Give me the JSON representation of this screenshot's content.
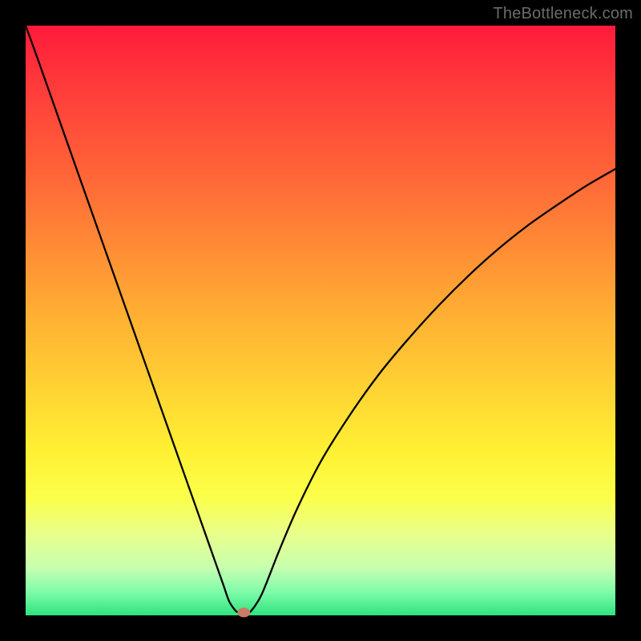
{
  "watermark": "TheBottleneck.com",
  "marker": {
    "color": "#cb7a66",
    "rx": 8,
    "ry": 6
  },
  "chart_data": {
    "type": "line",
    "title": "",
    "xlabel": "",
    "ylabel": "",
    "xlim": [
      0,
      100
    ],
    "ylim": [
      0,
      100
    ],
    "grid": false,
    "legend": false,
    "x": [
      0,
      2,
      5,
      8,
      11,
      14,
      17,
      20,
      23,
      26,
      29,
      32,
      33.5,
      34.5,
      35.5,
      36,
      36.5,
      37,
      38,
      40,
      43,
      46,
      50,
      55,
      60,
      65,
      70,
      75,
      80,
      85,
      90,
      95,
      100
    ],
    "values": [
      100,
      94.5,
      86,
      77.5,
      69,
      60.5,
      52,
      43.5,
      35,
      26.5,
      18,
      9.5,
      5.25,
      2.4,
      0.9,
      0.5,
      0.5,
      0.5,
      0.5,
      3.5,
      11,
      18,
      26,
      34,
      41,
      47,
      52.5,
      57.5,
      62,
      66,
      69.5,
      72.8,
      75.7
    ],
    "marker_point": {
      "x": 37,
      "y": 0.5
    }
  }
}
